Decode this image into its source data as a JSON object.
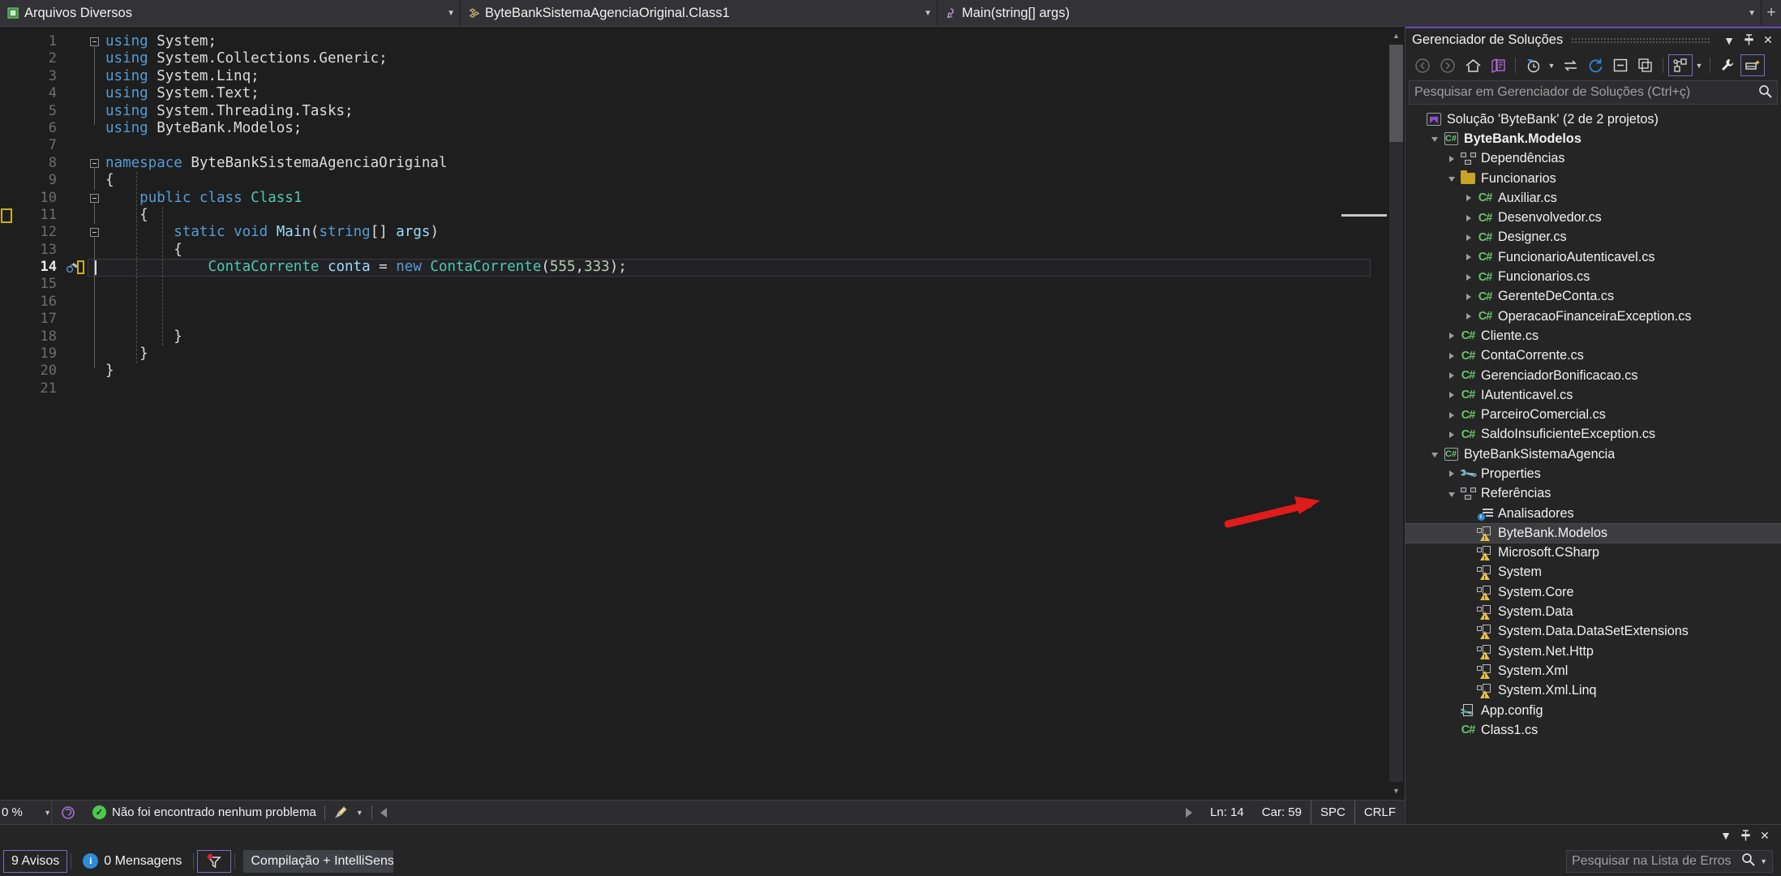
{
  "navbar": {
    "files_dropdown": {
      "label": "Arquivos Diversos",
      "icon": "misc-files-icon"
    },
    "class_dropdown": {
      "label": "ByteBankSistemaAgenciaOriginal.Class1",
      "icon": "class-icon"
    },
    "member_dropdown": {
      "label": "Main(string[] args)",
      "icon": "method-icon"
    },
    "add_label": "+"
  },
  "editor": {
    "lines": [
      {
        "n": "1",
        "tokens": [
          {
            "t": "using",
            "c": "k-blue"
          },
          {
            "t": " System;",
            "c": "k-punc"
          }
        ],
        "fold": "open-start"
      },
      {
        "n": "2",
        "tokens": [
          {
            "t": "using",
            "c": "k-blue"
          },
          {
            "t": " System.Collections.Generic;",
            "c": "k-punc"
          }
        ],
        "fold": "line"
      },
      {
        "n": "3",
        "tokens": [
          {
            "t": "using",
            "c": "k-blue"
          },
          {
            "t": " System.Linq;",
            "c": "k-punc"
          }
        ],
        "fold": "line"
      },
      {
        "n": "4",
        "tokens": [
          {
            "t": "using",
            "c": "k-blue"
          },
          {
            "t": " System.Text;",
            "c": "k-punc"
          }
        ],
        "fold": "line"
      },
      {
        "n": "5",
        "tokens": [
          {
            "t": "using",
            "c": "k-blue"
          },
          {
            "t": " System.Threading.Tasks;",
            "c": "k-punc"
          }
        ],
        "fold": "line"
      },
      {
        "n": "6",
        "tokens": [
          {
            "t": "using",
            "c": "k-blue"
          },
          {
            "t": " ByteBank.Modelos;",
            "c": "k-punc"
          }
        ],
        "fold": "end"
      },
      {
        "n": "7",
        "tokens": [],
        "fold": "none"
      },
      {
        "n": "8",
        "tokens": [
          {
            "t": "namespace",
            "c": "k-blue"
          },
          {
            "t": " ByteBankSistemaAgenciaOriginal",
            "c": "k-punc"
          }
        ],
        "fold": "open-start"
      },
      {
        "n": "9",
        "tokens": [
          {
            "t": "{",
            "c": "k-punc"
          }
        ],
        "fold": "line"
      },
      {
        "n": "10",
        "tokens": [
          {
            "t": "    ",
            "c": "k-punc"
          },
          {
            "t": "public",
            "c": "k-blue"
          },
          {
            "t": " ",
            "c": "k-punc"
          },
          {
            "t": "class",
            "c": "k-blue"
          },
          {
            "t": " ",
            "c": "k-punc"
          },
          {
            "t": "Class1",
            "c": "k-type"
          }
        ],
        "fold": "open-nested"
      },
      {
        "n": "11",
        "tokens": [
          {
            "t": "    {",
            "c": "k-punc"
          }
        ],
        "fold": "line"
      },
      {
        "n": "12",
        "tokens": [
          {
            "t": "        ",
            "c": "k-punc"
          },
          {
            "t": "static",
            "c": "k-blue"
          },
          {
            "t": " ",
            "c": "k-punc"
          },
          {
            "t": "void",
            "c": "k-blue"
          },
          {
            "t": " ",
            "c": "k-punc"
          },
          {
            "t": "Main",
            "c": "k-var"
          },
          {
            "t": "(",
            "c": "k-punc"
          },
          {
            "t": "string",
            "c": "k-blue"
          },
          {
            "t": "[] ",
            "c": "k-punc"
          },
          {
            "t": "args",
            "c": "k-var"
          },
          {
            "t": ")",
            "c": "k-punc"
          }
        ],
        "fold": "open-nested2"
      },
      {
        "n": "13",
        "tokens": [
          {
            "t": "        {",
            "c": "k-punc"
          }
        ],
        "fold": "line"
      },
      {
        "n": "14",
        "tokens": [
          {
            "t": "            ",
            "c": "k-punc"
          },
          {
            "t": "ContaCorrente",
            "c": "k-type"
          },
          {
            "t": " ",
            "c": "k-punc"
          },
          {
            "t": "conta",
            "c": "k-var"
          },
          {
            "t": " = ",
            "c": "k-punc"
          },
          {
            "t": "new",
            "c": "k-blue"
          },
          {
            "t": " ",
            "c": "k-punc"
          },
          {
            "t": "ContaCorrente",
            "c": "k-type"
          },
          {
            "t": "(",
            "c": "k-punc"
          },
          {
            "t": "555",
            "c": "k-num"
          },
          {
            "t": ",",
            "c": "k-punc"
          },
          {
            "t": "333",
            "c": "k-num"
          },
          {
            "t": ");",
            "c": "k-punc"
          }
        ],
        "fold": "line",
        "active": true
      },
      {
        "n": "15",
        "tokens": [],
        "fold": "line"
      },
      {
        "n": "16",
        "tokens": [],
        "fold": "line"
      },
      {
        "n": "17",
        "tokens": [],
        "fold": "line"
      },
      {
        "n": "18",
        "tokens": [
          {
            "t": "        }",
            "c": "k-punc"
          }
        ],
        "fold": "line"
      },
      {
        "n": "19",
        "tokens": [
          {
            "t": "    }",
            "c": "k-punc"
          }
        ],
        "fold": "line"
      },
      {
        "n": "20",
        "tokens": [
          {
            "t": "}",
            "c": "k-punc"
          }
        ],
        "fold": "end"
      },
      {
        "n": "21",
        "tokens": [],
        "fold": "none"
      }
    ]
  },
  "editor_status": {
    "zoom": "0 %",
    "problem_text": "Não foi encontrado nenhum problema",
    "line_label": "Ln: 14",
    "col_label": "Car: 59",
    "spaces": "SPC",
    "eol": "CRLF"
  },
  "solution_explorer": {
    "title": "Gerenciador de Soluções",
    "search_placeholder": "Pesquisar em Gerenciador de Soluções (Ctrl+ç)",
    "toolbar_icons": [
      "back-icon",
      "forward-icon",
      "home-icon",
      "sync-with-active-document-icon",
      "pending-changes-filter-icon",
      "collapse-expand-icon",
      "refresh-icon",
      "collapse-all-icon",
      "show-all-files-icon",
      "view-class-diagram-icon",
      "properties-icon",
      "preview-selected-items-icon"
    ],
    "tree": [
      {
        "label": "Solução 'ByteBank' (2 de 2 projetos)",
        "indent": 0,
        "expander": "none",
        "icon": "solution-icon",
        "bold": false,
        "selected": false
      },
      {
        "label": "ByteBank.Modelos",
        "indent": 1,
        "expander": "open",
        "icon": "csharp-project-icon",
        "bold": true,
        "selected": false
      },
      {
        "label": "Dependências",
        "indent": 2,
        "expander": "closed",
        "icon": "dependencies-icon",
        "bold": false,
        "selected": false
      },
      {
        "label": "Funcionarios",
        "indent": 2,
        "expander": "open",
        "icon": "folder-icon",
        "bold": false,
        "selected": false
      },
      {
        "label": "Auxiliar.cs",
        "indent": 3,
        "expander": "closed",
        "icon": "csharp-file-icon",
        "bold": false,
        "selected": false
      },
      {
        "label": "Desenvolvedor.cs",
        "indent": 3,
        "expander": "closed",
        "icon": "csharp-file-icon",
        "bold": false,
        "selected": false
      },
      {
        "label": "Designer.cs",
        "indent": 3,
        "expander": "closed",
        "icon": "csharp-file-icon",
        "bold": false,
        "selected": false
      },
      {
        "label": "FuncionarioAutenticavel.cs",
        "indent": 3,
        "expander": "closed",
        "icon": "csharp-file-icon",
        "bold": false,
        "selected": false
      },
      {
        "label": "Funcionarios.cs",
        "indent": 3,
        "expander": "closed",
        "icon": "csharp-file-icon",
        "bold": false,
        "selected": false
      },
      {
        "label": "GerenteDeConta.cs",
        "indent": 3,
        "expander": "closed",
        "icon": "csharp-file-icon",
        "bold": false,
        "selected": false
      },
      {
        "label": "OperacaoFinanceiraException.cs",
        "indent": 3,
        "expander": "closed",
        "icon": "csharp-file-icon",
        "bold": false,
        "selected": false
      },
      {
        "label": "Cliente.cs",
        "indent": 2,
        "expander": "closed",
        "icon": "csharp-file-icon",
        "bold": false,
        "selected": false
      },
      {
        "label": "ContaCorrente.cs",
        "indent": 2,
        "expander": "closed",
        "icon": "csharp-file-icon",
        "bold": false,
        "selected": false
      },
      {
        "label": "GerenciadorBonificacao.cs",
        "indent": 2,
        "expander": "closed",
        "icon": "csharp-file-icon",
        "bold": false,
        "selected": false
      },
      {
        "label": "IAutenticavel.cs",
        "indent": 2,
        "expander": "closed",
        "icon": "csharp-file-icon",
        "bold": false,
        "selected": false
      },
      {
        "label": "ParceiroComercial.cs",
        "indent": 2,
        "expander": "closed",
        "icon": "csharp-file-icon",
        "bold": false,
        "selected": false
      },
      {
        "label": "SaldoInsuficienteException.cs",
        "indent": 2,
        "expander": "closed",
        "icon": "csharp-file-icon",
        "bold": false,
        "selected": false
      },
      {
        "label": "ByteBankSistemaAgencia",
        "indent": 1,
        "expander": "open",
        "icon": "csharp-project-icon",
        "bold": false,
        "selected": false
      },
      {
        "label": "Properties",
        "indent": 2,
        "expander": "closed",
        "icon": "properties-icon",
        "bold": false,
        "selected": false
      },
      {
        "label": "Referências",
        "indent": 2,
        "expander": "open",
        "icon": "references-icon",
        "bold": false,
        "selected": false
      },
      {
        "label": "Analisadores",
        "indent": 3,
        "expander": "none",
        "icon": "analyzers-icon",
        "bold": false,
        "selected": false
      },
      {
        "label": "ByteBank.Modelos",
        "indent": 3,
        "expander": "none",
        "icon": "warning-reference-icon",
        "bold": false,
        "selected": true
      },
      {
        "label": "Microsoft.CSharp",
        "indent": 3,
        "expander": "none",
        "icon": "warning-reference-icon",
        "bold": false,
        "selected": false
      },
      {
        "label": "System",
        "indent": 3,
        "expander": "none",
        "icon": "warning-reference-icon",
        "bold": false,
        "selected": false
      },
      {
        "label": "System.Core",
        "indent": 3,
        "expander": "none",
        "icon": "warning-reference-icon",
        "bold": false,
        "selected": false
      },
      {
        "label": "System.Data",
        "indent": 3,
        "expander": "none",
        "icon": "warning-reference-icon",
        "bold": false,
        "selected": false
      },
      {
        "label": "System.Data.DataSetExtensions",
        "indent": 3,
        "expander": "none",
        "icon": "warning-reference-icon",
        "bold": false,
        "selected": false
      },
      {
        "label": "System.Net.Http",
        "indent": 3,
        "expander": "none",
        "icon": "warning-reference-icon",
        "bold": false,
        "selected": false
      },
      {
        "label": "System.Xml",
        "indent": 3,
        "expander": "none",
        "icon": "warning-reference-icon",
        "bold": false,
        "selected": false
      },
      {
        "label": "System.Xml.Linq",
        "indent": 3,
        "expander": "none",
        "icon": "warning-reference-icon",
        "bold": false,
        "selected": false
      },
      {
        "label": "App.config",
        "indent": 2,
        "expander": "none",
        "icon": "config-file-icon",
        "bold": false,
        "selected": false
      },
      {
        "label": "Class1.cs",
        "indent": 2,
        "expander": "none",
        "icon": "csharp-file-icon",
        "bold": false,
        "selected": false
      }
    ]
  },
  "error_list": {
    "warnings_label": "9 Avisos",
    "messages_label": "0 Mensagens",
    "filter_icon": "error-filter-icon",
    "scope_label": "Compilação + IntelliSens",
    "search_placeholder": "Pesquisar na Lista de Erros"
  },
  "colors": {
    "accent_purple": "#6a3fbf",
    "selection": "#3e3e40",
    "annotation_red": "#e01b1b",
    "warning_yellow": "#e8c04a",
    "csharp_green": "#6ac46a"
  }
}
